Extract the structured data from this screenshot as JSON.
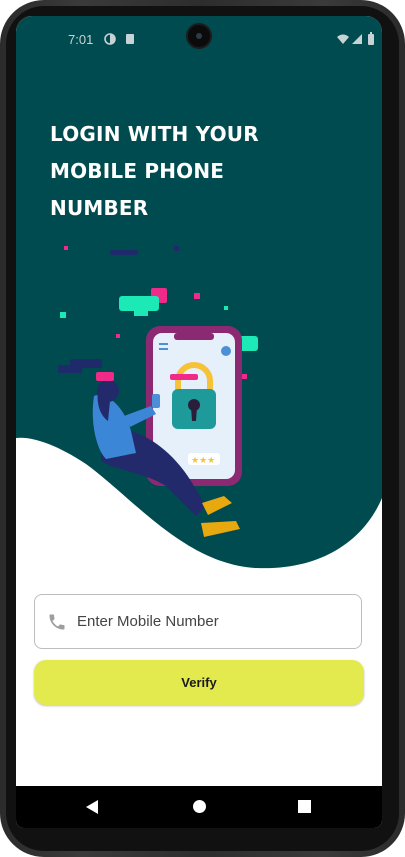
{
  "status_bar": {
    "time": "7:01"
  },
  "login": {
    "headline_line1": "LOGIN WITH YOUR",
    "headline_line2": "MOBILE PHONE",
    "headline_line3": "NUMBER",
    "phone_field": {
      "value": "",
      "placeholder": "Enter Mobile Number",
      "icon": "phone-icon"
    },
    "verify_label": "Verify"
  },
  "colors": {
    "hero_background": "#004b4f",
    "button": "#e3ea4d",
    "accent_pink": "#ef2a88",
    "accent_teal": "#1de9b6"
  },
  "nav": {
    "back_icon": "back-triangle-icon",
    "home_icon": "home-circle-icon",
    "recents_icon": "recents-square-icon"
  }
}
